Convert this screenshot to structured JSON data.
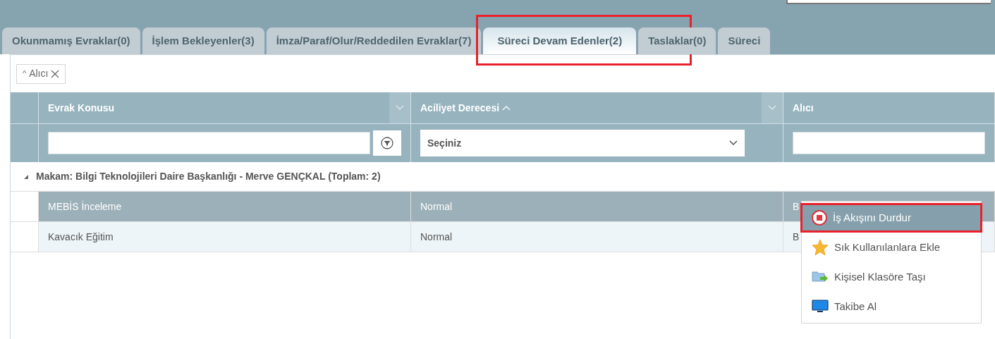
{
  "tabs": [
    {
      "label": "Okunmamış Evraklar(0)",
      "selected": false
    },
    {
      "label": "İşlem Bekleyenler(3)",
      "selected": false
    },
    {
      "label": "İmza/Paraf/Olur/Reddedilen Evraklar(7)",
      "selected": false
    },
    {
      "label": "Süreci Devam Edenler(2)",
      "selected": true,
      "highlighted": true
    },
    {
      "label": "Taslaklar(0)",
      "selected": false
    },
    {
      "label": "Süreci",
      "selected": false
    }
  ],
  "group_chip": {
    "arrow": "^",
    "label": "Alıcı"
  },
  "table": {
    "columns": [
      {
        "label": "Evrak Konusu",
        "sorted": false,
        "filter": {
          "kind": "text_button"
        }
      },
      {
        "label": "Aciliyet Derecesi",
        "sorted": true,
        "filter": {
          "kind": "select",
          "placeholder": "Seçiniz"
        }
      },
      {
        "label": "Alıcı",
        "sorted": false,
        "filter": {
          "kind": "text"
        }
      }
    ],
    "group": {
      "label": "Makam: Bilgi Teknolojileri Daire Başkanlığı - Merve GENÇKAL (Toplam: 2)",
      "expanded": true
    },
    "rows": [
      {
        "cells": [
          "MEBİS İnceleme",
          "Normal",
          "B"
        ],
        "selected": true
      },
      {
        "cells": [
          "Kavacık Eğitim",
          "Normal",
          "B"
        ],
        "selected": false
      }
    ]
  },
  "context_menu": {
    "items": [
      {
        "label": "İş Akışını Durdur",
        "kind": "stop",
        "selected": true,
        "highlighted": true
      },
      {
        "label": "Sık Kullanılanlara Ekle",
        "kind": "star",
        "selected": false
      },
      {
        "label": "Kişisel Klasöre Taşı",
        "kind": "move",
        "selected": false
      },
      {
        "label": "Takibe Al",
        "kind": "monitor",
        "selected": false
      }
    ]
  }
}
